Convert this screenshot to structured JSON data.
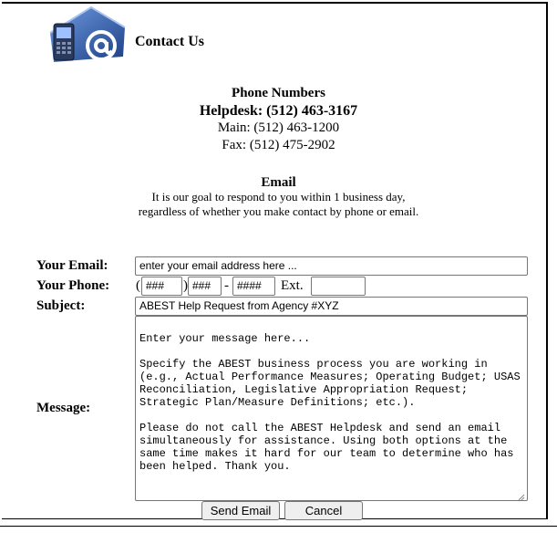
{
  "header": {
    "title": "Contact Us",
    "logo_icon": "email-at-phone-icon"
  },
  "phones": {
    "heading": "Phone Numbers",
    "helpdesk": "Helpdesk: (512) 463-3167",
    "main": "Main: (512) 463-1200",
    "fax": "Fax: (512) 475-2902"
  },
  "email_info": {
    "heading": "Email",
    "line1": "It is our goal to respond to you within 1 business day,",
    "line2": "regardless of whether you make contact by phone or email."
  },
  "form": {
    "email_label": "Your Email:",
    "email_value": "enter your email address here ...",
    "phone_label": "Your Phone:",
    "phone_open_paren": "(",
    "phone_area": "###",
    "phone_close_paren": ")",
    "phone_prefix": "###",
    "phone_dash": "-",
    "phone_line": "####",
    "ext_label": "Ext.",
    "ext_value": "",
    "subject_label": "Subject:",
    "subject_value": "ABEST Help Request from Agency #XYZ",
    "message_label": "Message:",
    "message_value": "\nEnter your message here...\n\nSpecify the ABEST business process you are working in (e.g., Actual Performance Measures; Operating Budget; USAS Reconciliation, Legislative Appropriation Request; Strategic Plan/Measure Definitions; etc.).\n\nPlease do not call the ABEST Helpdesk and send an email simultaneously for assistance. Using both options at the same time makes it hard for our team to determine who has been helped. Thank you."
  },
  "buttons": {
    "send": "Send Email",
    "cancel": "Cancel"
  },
  "colors": {
    "logo_blue": "#2f5fb0",
    "logo_dark": "#1d2f5a"
  }
}
